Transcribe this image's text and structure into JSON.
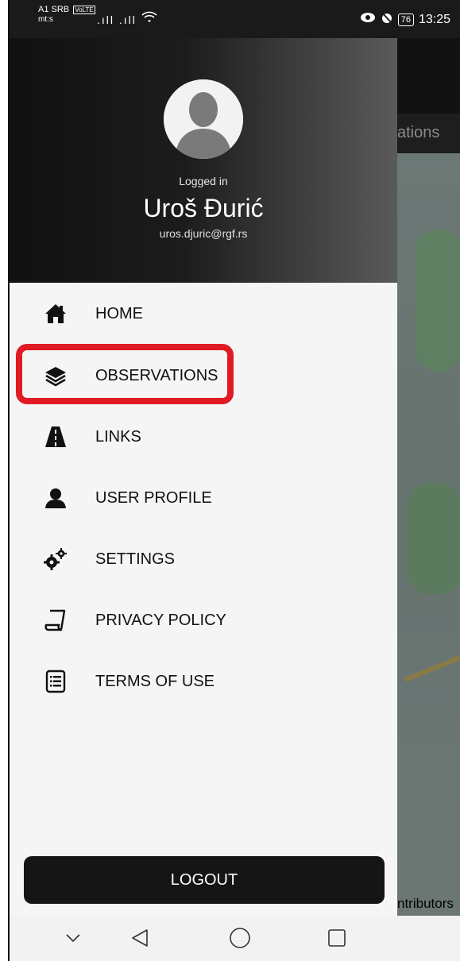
{
  "statusbar": {
    "carrier_line1": "A1 SRB",
    "volte": "VoLTE",
    "carrier_line2": "mt:s",
    "signal": ".ıll .ıll",
    "battery": "76",
    "time": "13:25"
  },
  "map": {
    "tab_partial": "ations",
    "attribution_partial": "ntributors"
  },
  "drawer": {
    "logged_label": "Logged in",
    "user_name": "Uroš Đurić",
    "user_email": "uros.djuric@rgf.rs",
    "items": [
      {
        "label": "HOME",
        "icon": "home-icon"
      },
      {
        "label": "OBSERVATIONS",
        "icon": "layers-icon"
      },
      {
        "label": "LINKS",
        "icon": "road-icon"
      },
      {
        "label": "USER PROFILE",
        "icon": "user-icon"
      },
      {
        "label": "SETTINGS",
        "icon": "gears-icon"
      },
      {
        "label": "PRIVACY POLICY",
        "icon": "scroll-icon"
      },
      {
        "label": "TERMS OF USE",
        "icon": "document-list-icon"
      }
    ],
    "logout_label": "LOGOUT"
  },
  "colors": {
    "highlight": "#e01b24",
    "drawer_bg": "#f5f5f5",
    "header_dark": "#111111"
  }
}
